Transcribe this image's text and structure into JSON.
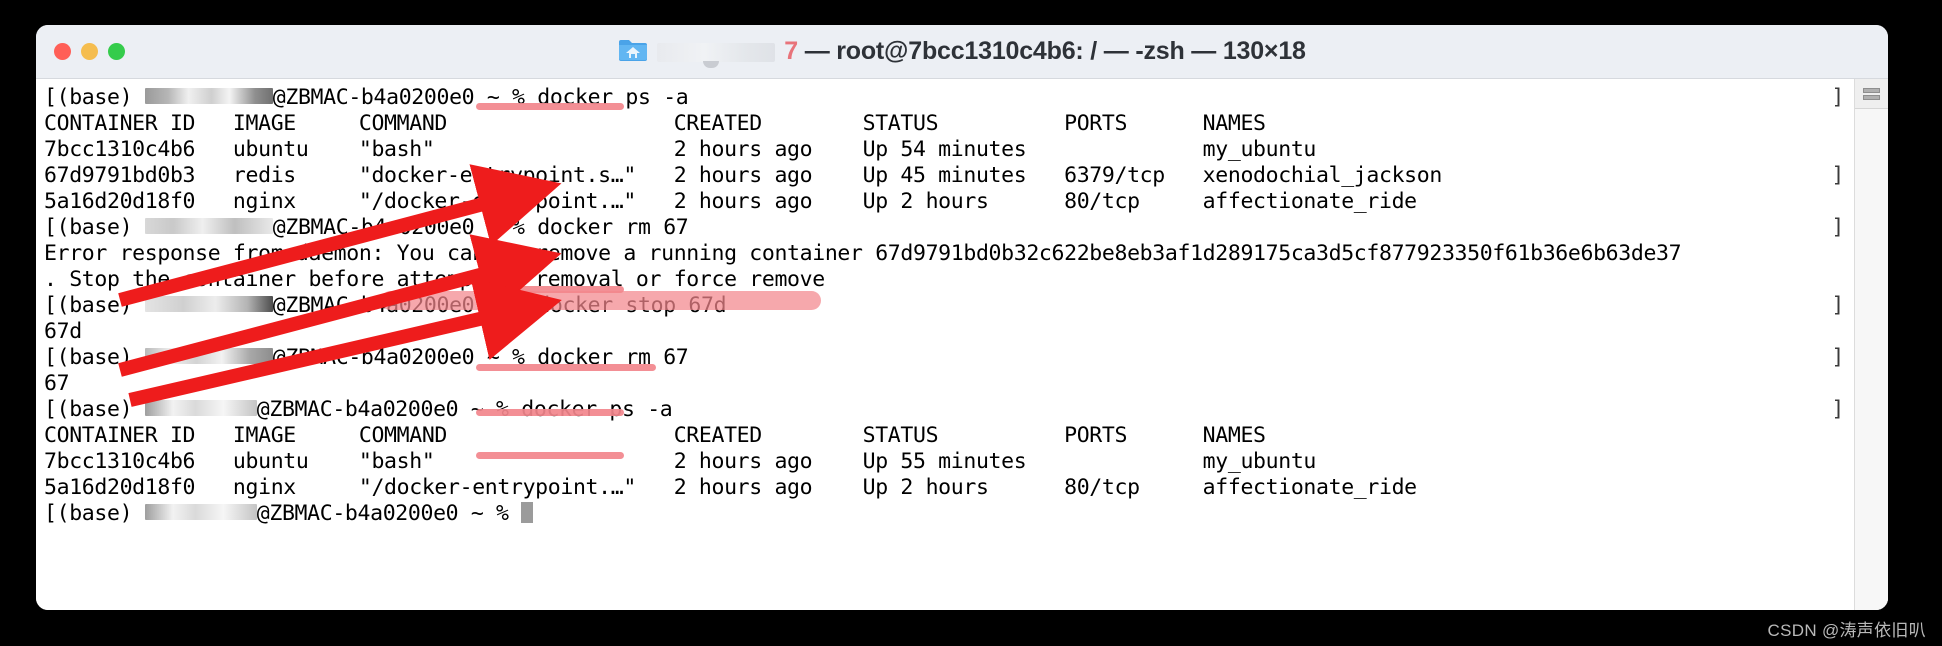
{
  "window": {
    "title_prefix_redacted": true,
    "title": "7 — root@7bcc1310c4b6: / — -zsh — 130×18",
    "title_pink_char": "7",
    "title_rest": " — root@7bcc1310c4b6: / — -zsh — 130×18",
    "folder_icon": "folder-home-icon",
    "buttons": {
      "close": "close-button",
      "minimize": "minimize-button",
      "zoom": "zoom-button"
    },
    "colors": {
      "close": "#ff5f57",
      "minimize": "#f5bd4f",
      "zoom": "#35cc4b",
      "titlebar": "#eceff4",
      "body": "#ffffff",
      "highlight_pink": "#f2868c",
      "arrow_red": "#ee1c1c"
    }
  },
  "scrollbar": {
    "grabber_icon": "resize-grabber-icon"
  },
  "terminal": {
    "prompt_prefix": "[(base) ",
    "prompt_host": "@ZBMAC-b4a0200e0 ~ % ",
    "line_end_bracket": "]",
    "lines": [
      {
        "type": "prompt",
        "command": "docker ps -a"
      },
      {
        "type": "header",
        "text": "CONTAINER ID   IMAGE     COMMAND                  CREATED        STATUS          PORTS      NAMES"
      },
      {
        "type": "row",
        "text": "7bcc1310c4b6   ubuntu    \"bash\"                   2 hours ago    Up 54 minutes              my_ubuntu"
      },
      {
        "type": "row",
        "text": "67d9791bd0b3   redis     \"docker-entrypoint.s…\"   2 hours ago    Up 45 minutes   6379/tcp   xenodochial_jackson"
      },
      {
        "type": "row",
        "text": "5a16d20d18f0   nginx     \"/docker-entrypoint.…\"   2 hours ago    Up 2 hours      80/tcp     affectionate_ride"
      },
      {
        "type": "prompt",
        "command": "docker rm 67"
      },
      {
        "type": "output",
        "text": "Error response from daemon: You cannot remove a running container 67d9791bd0b32c622be8eb3af1d289175ca3d5cf877923350f61b36e6b63de37"
      },
      {
        "type": "output",
        "text": ". Stop the container before attempting removal or force remove"
      },
      {
        "type": "prompt",
        "command": "docker stop 67d"
      },
      {
        "type": "output",
        "text": "67d"
      },
      {
        "type": "prompt",
        "command": "docker rm 67"
      },
      {
        "type": "output",
        "text": "67"
      },
      {
        "type": "prompt",
        "command": "docker ps -a"
      },
      {
        "type": "header",
        "text": "CONTAINER ID   IMAGE     COMMAND                  CREATED        STATUS          PORTS      NAMES"
      },
      {
        "type": "row",
        "text": "7bcc1310c4b6   ubuntu    \"bash\"                   2 hours ago    Up 55 minutes              my_ubuntu"
      },
      {
        "type": "row",
        "text": "5a16d20d18f0   nginx     \"/docker-entrypoint.…\"   2 hours ago    Up 2 hours      80/tcp     affectionate_ride"
      },
      {
        "type": "prompt_cursor",
        "command": ""
      }
    ],
    "table_columns": [
      "CONTAINER ID",
      "IMAGE",
      "COMMAND",
      "CREATED",
      "STATUS",
      "PORTS",
      "NAMES"
    ],
    "ps_first": {
      "rows": [
        {
          "id": "7bcc1310c4b6",
          "image": "ubuntu",
          "command": "\"bash\"",
          "created": "2 hours ago",
          "status": "Up 54 minutes",
          "ports": "",
          "names": "my_ubuntu"
        },
        {
          "id": "67d9791bd0b3",
          "image": "redis",
          "command": "\"docker-entrypoint.s…\"",
          "created": "2 hours ago",
          "status": "Up 45 minutes",
          "ports": "6379/tcp",
          "names": "xenodochial_jackson"
        },
        {
          "id": "5a16d20d18f0",
          "image": "nginx",
          "command": "\"/docker-entrypoint.…\"",
          "created": "2 hours ago",
          "status": "Up 2 hours",
          "ports": "80/tcp",
          "names": "affectionate_ride"
        }
      ]
    },
    "ps_second": {
      "rows": [
        {
          "id": "7bcc1310c4b6",
          "image": "ubuntu",
          "command": "\"bash\"",
          "created": "2 hours ago",
          "status": "Up 55 minutes",
          "ports": "",
          "names": "my_ubuntu"
        },
        {
          "id": "5a16d20d18f0",
          "image": "nginx",
          "command": "\"/docker-entrypoint.…\"",
          "created": "2 hours ago",
          "status": "Up 2 hours",
          "ports": "80/tcp",
          "names": "affectionate_ride"
        }
      ]
    }
  },
  "annotations": {
    "arrow_count": 3,
    "highlight_targets": [
      "docker ps -a",
      "docker rm 67",
      "docker stop 67d",
      "docker rm 67",
      "docker ps -a",
      "You cannot remove a running container"
    ]
  },
  "watermark": "CSDN @涛声依旧叭"
}
